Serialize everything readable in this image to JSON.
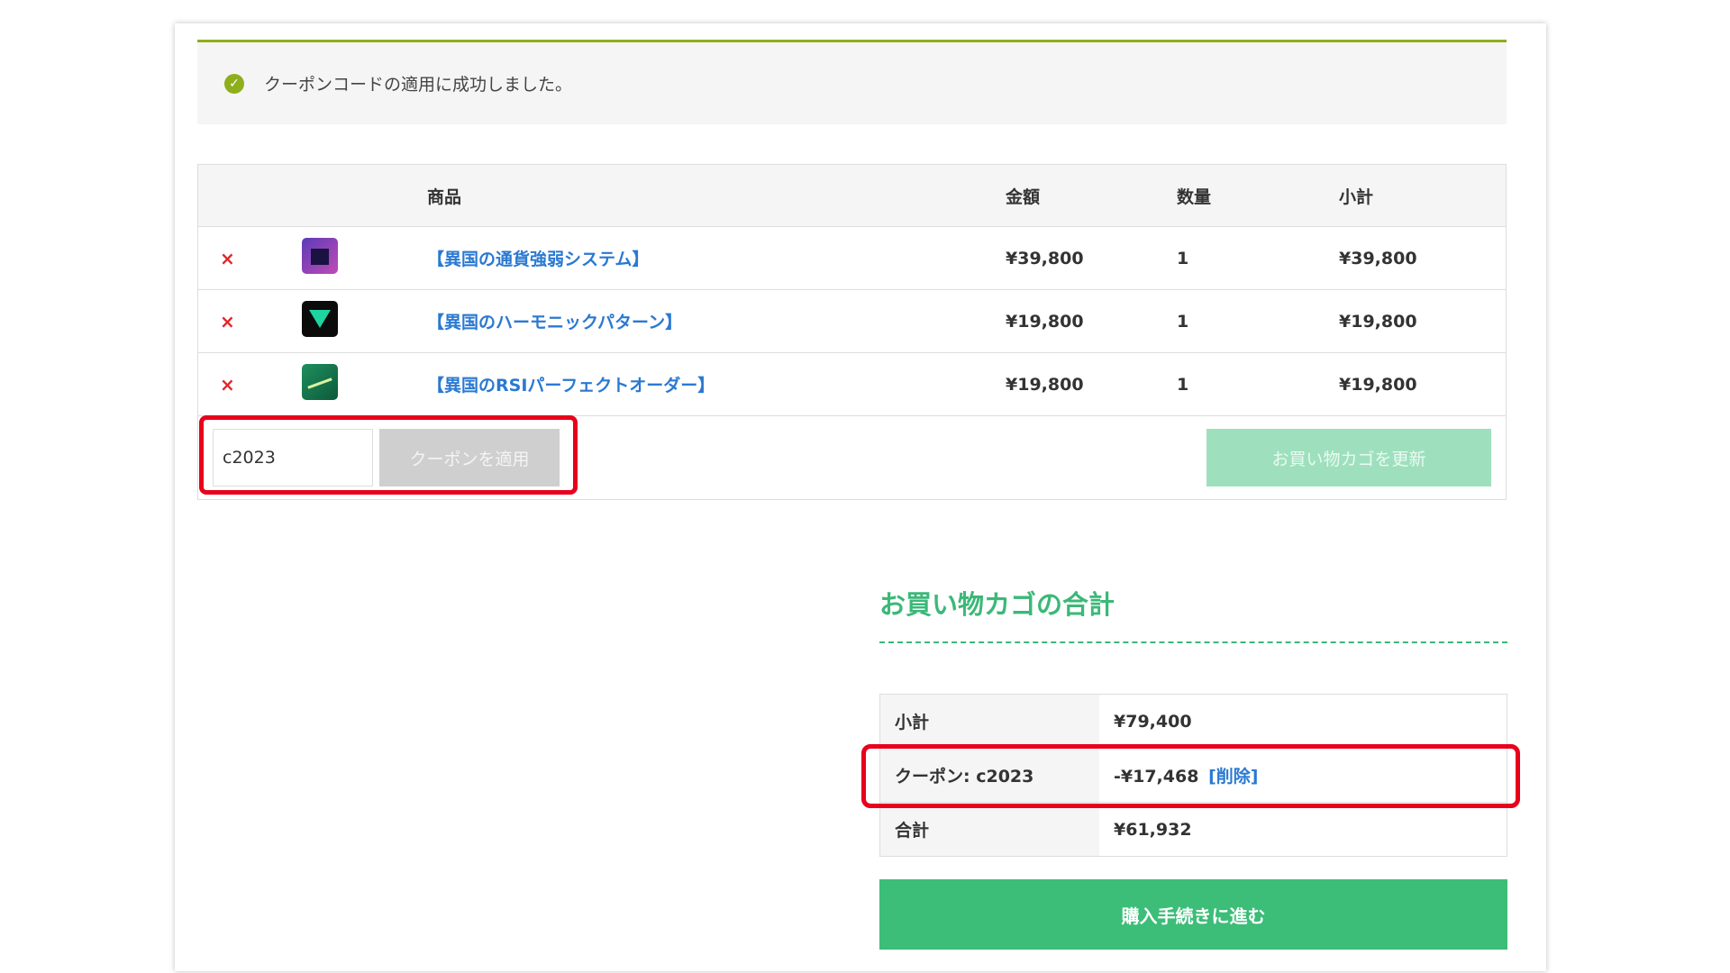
{
  "notice": {
    "message": "クーポンコードの適用に成功しました。"
  },
  "cart": {
    "headers": {
      "product": "商品",
      "price": "金額",
      "quantity": "数量",
      "subtotal": "小計"
    },
    "items": [
      {
        "name": "【異国の通貨強弱システム】",
        "price": "¥39,800",
        "quantity": "1",
        "subtotal": "¥39,800",
        "remove": "×"
      },
      {
        "name": "【異国のハーモニックパターン】",
        "price": "¥19,800",
        "quantity": "1",
        "subtotal": "¥19,800",
        "remove": "×"
      },
      {
        "name": "【異国のRSIパーフェクトオーダー】",
        "price": "¥19,800",
        "quantity": "1",
        "subtotal": "¥19,800",
        "remove": "×"
      }
    ],
    "coupon_value": "c2023",
    "apply_label": "クーポンを適用",
    "update_label": "お買い物カゴを更新"
  },
  "totals": {
    "title": "お買い物カゴの合計",
    "subtotal_label": "小計",
    "subtotal_value": "¥79,400",
    "coupon_label": "クーポン: c2023",
    "coupon_value": "-¥17,468",
    "coupon_remove": "[削除]",
    "total_label": "合計",
    "total_value": "¥61,932"
  },
  "checkout_label": "購入手続きに進む",
  "colors": {
    "accent": "#3cb878",
    "notice_bar": "#8fae1b",
    "highlight": "#e8001c",
    "link": "#2a79d2"
  }
}
